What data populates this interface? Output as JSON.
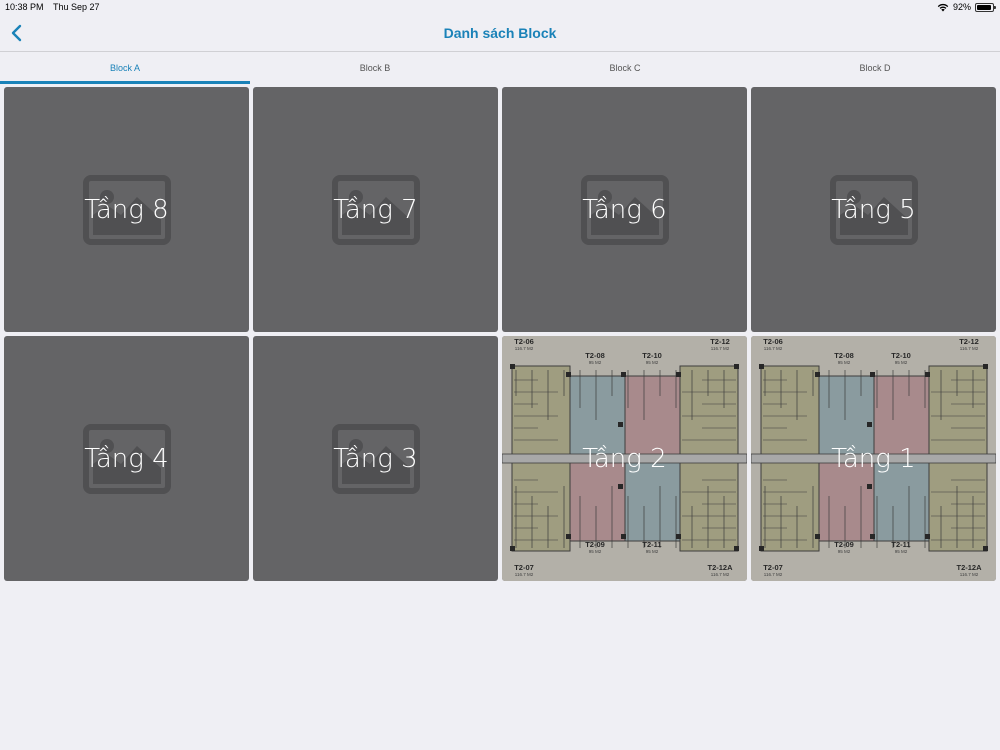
{
  "status_bar": {
    "time": "10:38 PM",
    "date": "Thu Sep 27",
    "battery": "92%"
  },
  "nav": {
    "title": "Danh sách Block"
  },
  "tabs": [
    {
      "label": "Block A",
      "active": true
    },
    {
      "label": "Block B",
      "active": false
    },
    {
      "label": "Block C",
      "active": false
    },
    {
      "label": "Block D",
      "active": false
    }
  ],
  "floors": [
    {
      "label": "Tầng 8",
      "image": "placeholder"
    },
    {
      "label": "Tầng 7",
      "image": "placeholder"
    },
    {
      "label": "Tầng 6",
      "image": "placeholder"
    },
    {
      "label": "Tầng 5",
      "image": "placeholder"
    },
    {
      "label": "Tầng 4",
      "image": "placeholder"
    },
    {
      "label": "Tầng 3",
      "image": "placeholder"
    },
    {
      "label": "Tầng 2",
      "image": "floorplan"
    },
    {
      "label": "Tầng 1",
      "image": "floorplan"
    }
  ],
  "floorplan_labels": {
    "top": [
      {
        "unit": "T2-06",
        "area": "116.7 M2"
      },
      {
        "unit": "T2-08",
        "area": "95 M2"
      },
      {
        "unit": "T2-10",
        "area": "95 M2"
      },
      {
        "unit": "T2-12",
        "area": "116.7 M2"
      }
    ],
    "bottom": [
      {
        "unit": "T2-07",
        "area": "116.7 M2"
      },
      {
        "unit": "T2-09",
        "area": "95 M2"
      },
      {
        "unit": "T2-11",
        "area": "95 M2"
      },
      {
        "unit": "T2-12A",
        "area": "116.7 M2"
      }
    ]
  },
  "colors": {
    "accent": "#1a82b8",
    "tile": "#646466",
    "background": "#efeff4"
  },
  "icons": {
    "back": "chevron-left-icon",
    "placeholder": "image-placeholder-icon",
    "wifi": "wifi-icon",
    "battery": "battery-icon"
  }
}
